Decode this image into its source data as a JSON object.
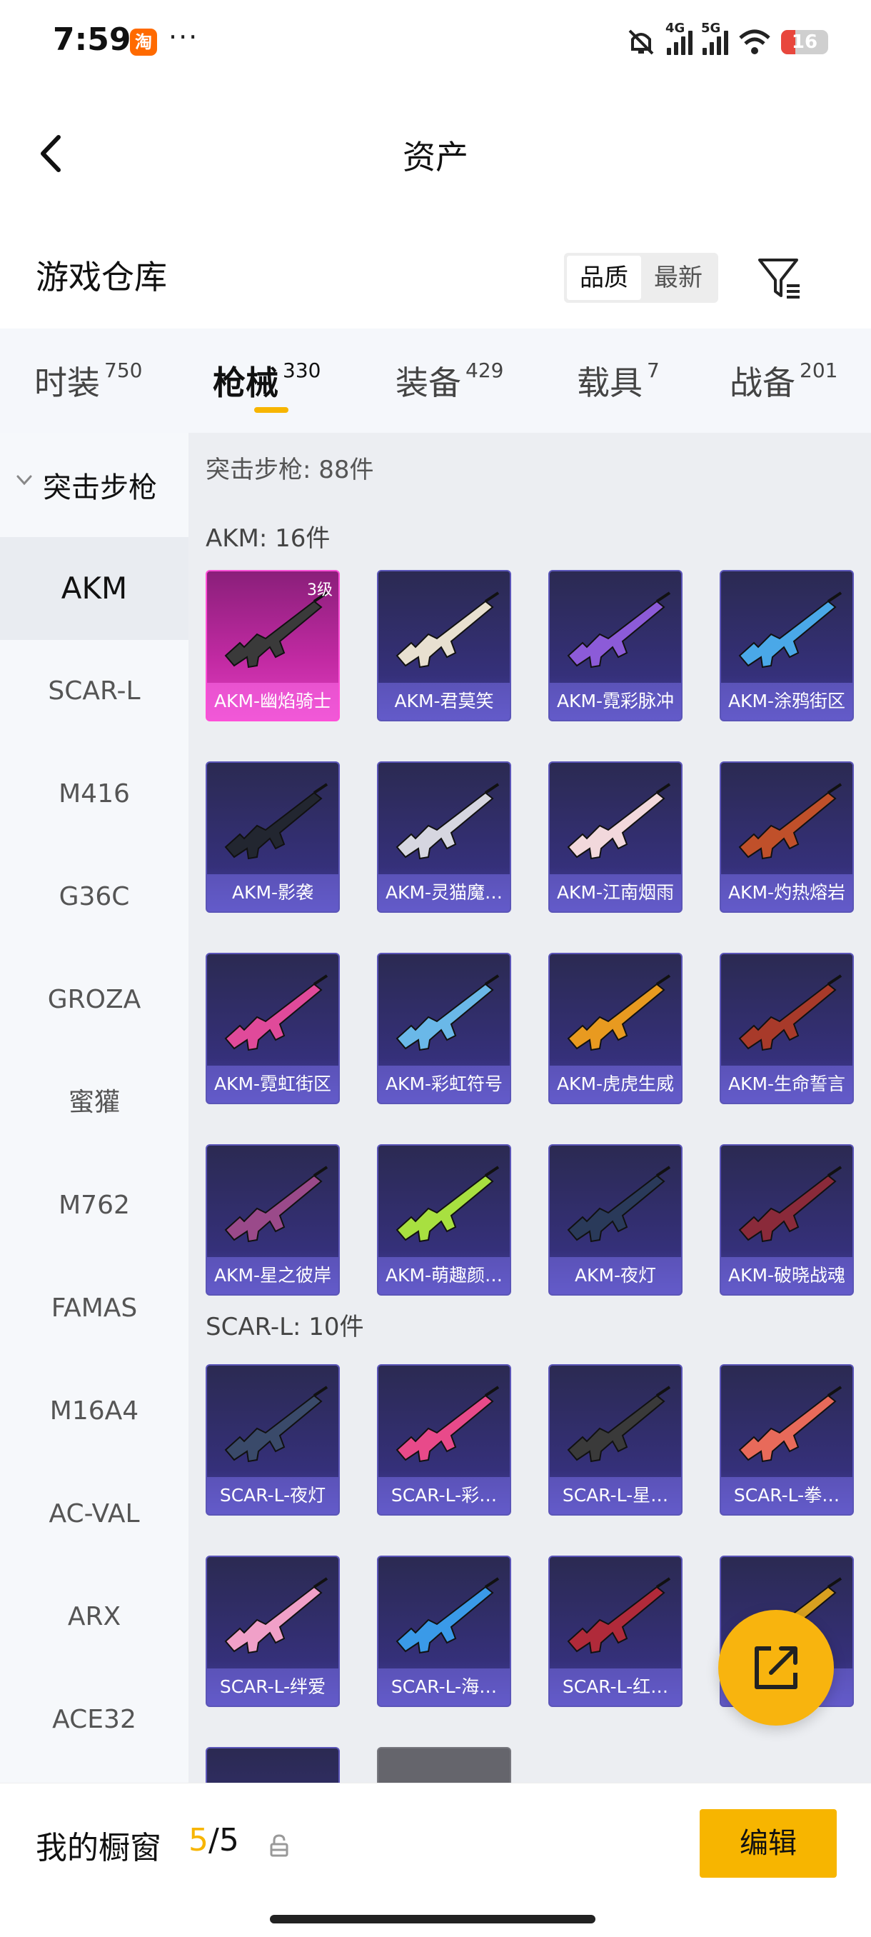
{
  "status": {
    "time": "7:59",
    "app_badge": "淘",
    "dots": "···",
    "net1": "4G",
    "net2": "5G",
    "battery": "16"
  },
  "nav": {
    "title": "资产"
  },
  "header": {
    "title": "游戏仓库",
    "sort_quality": "品质",
    "sort_latest": "最新"
  },
  "tabs": [
    {
      "label": "时装",
      "count": "750"
    },
    {
      "label": "枪械",
      "count": "330"
    },
    {
      "label": "装备",
      "count": "429"
    },
    {
      "label": "载具",
      "count": "7"
    },
    {
      "label": "战备",
      "count": "201"
    }
  ],
  "sidebar": {
    "category": "突击步枪",
    "items": [
      "AKM",
      "SCAR-L",
      "M416",
      "G36C",
      "GROZA",
      "蜜獾",
      "M762",
      "FAMAS",
      "M16A4",
      "AC-VAL",
      "ARX",
      "ACE32"
    ]
  },
  "content": {
    "summary": "突击步枪: 88件",
    "groups": [
      {
        "title": "AKM: 16件",
        "items": [
          {
            "name": "AKM-幽焰骑士",
            "level": "3级",
            "rarity": "legend",
            "color": "#3a3a3a"
          },
          {
            "name": "AKM-君莫笑",
            "color": "#e8e0d0"
          },
          {
            "name": "AKM-霓彩脉冲",
            "color": "#8c5bd8"
          },
          {
            "name": "AKM-涂鸦街区",
            "color": "#4aa8e8"
          },
          {
            "name": "AKM-影袭",
            "color": "#222630"
          },
          {
            "name": "AKM-灵猫魔…",
            "color": "#d6d6e0"
          },
          {
            "name": "AKM-江南烟雨",
            "color": "#f2d8dc"
          },
          {
            "name": "AKM-灼热熔岩",
            "color": "#c0502a"
          },
          {
            "name": "AKM-霓虹街区",
            "color": "#e04a9a"
          },
          {
            "name": "AKM-彩虹符号",
            "color": "#6ab8e8"
          },
          {
            "name": "AKM-虎虎生威",
            "color": "#e89a20"
          },
          {
            "name": "AKM-生命誓言",
            "color": "#a83a2a"
          },
          {
            "name": "AKM-星之彼岸",
            "color": "#9a4a8a"
          },
          {
            "name": "AKM-萌趣颜…",
            "color": "#a8e040"
          },
          {
            "name": "AKM-夜灯",
            "color": "#2a3a5a"
          },
          {
            "name": "AKM-破晓战魂",
            "color": "#8a2a3a"
          }
        ]
      },
      {
        "title": "SCAR-L: 10件",
        "items": [
          {
            "name": "SCAR-L-夜灯",
            "color": "#3a4a6a"
          },
          {
            "name": "SCAR-L-彩…",
            "color": "#e84a8a"
          },
          {
            "name": "SCAR-L-星…",
            "color": "#3a3a3a"
          },
          {
            "name": "SCAR-L-拳…",
            "color": "#e86a5a"
          },
          {
            "name": "SCAR-L-绊爱",
            "color": "#f0a0c8"
          },
          {
            "name": "SCAR-L-海…",
            "color": "#3a9ae8"
          },
          {
            "name": "SCAR-L-红…",
            "color": "#b02a3a"
          },
          {
            "name": "",
            "color": "#d8a020"
          }
        ]
      }
    ]
  },
  "bottom": {
    "label": "我的橱窗",
    "current": "5",
    "separator": "/",
    "total": "5",
    "edit": "编辑"
  }
}
